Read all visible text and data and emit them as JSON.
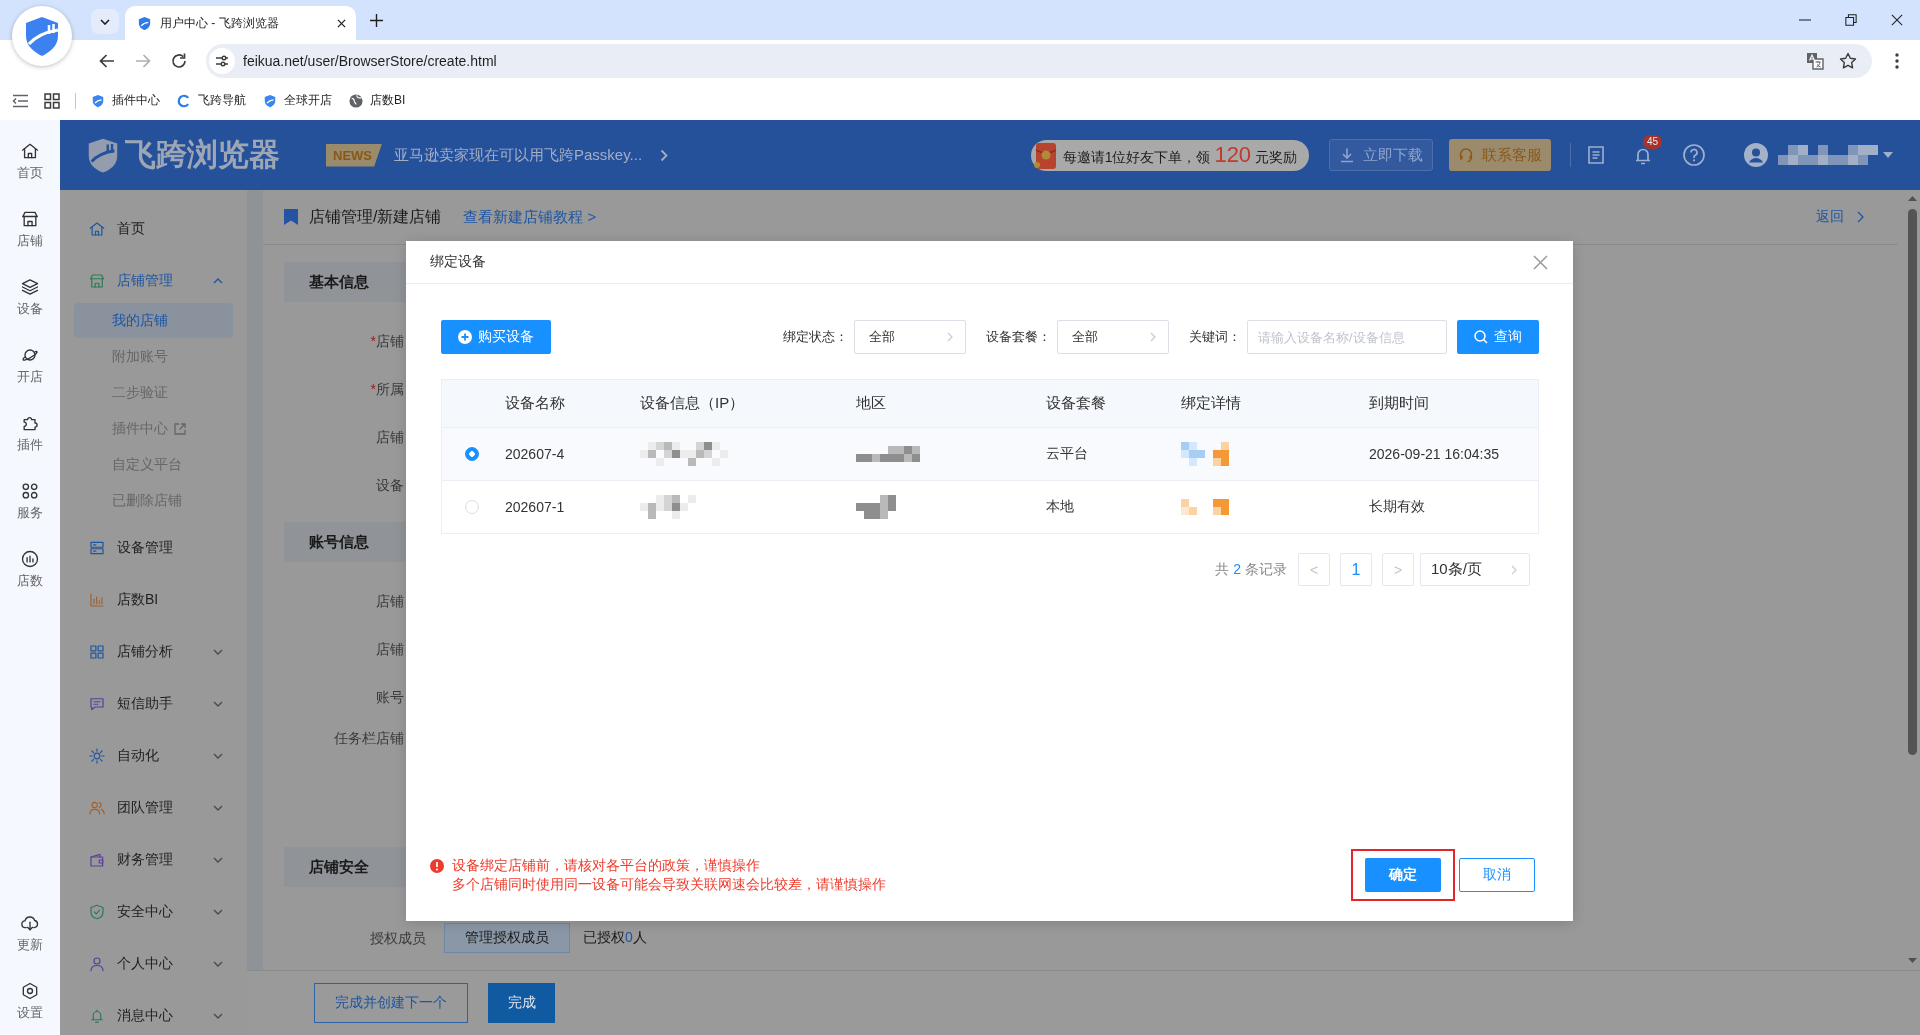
{
  "browser": {
    "tabs": [
      {
        "title": "用户中心 - 飞跨浏览器",
        "selected": true
      }
    ],
    "url": "feikua.net/user/BrowserStore/create.html",
    "bookmarks": [
      {
        "label": "插件中心"
      },
      {
        "label": "飞跨导航"
      },
      {
        "label": "全球开店"
      },
      {
        "label": "店数BI"
      }
    ]
  },
  "rail": {
    "items": [
      {
        "label": "首页",
        "selected": false
      },
      {
        "label": "店铺",
        "selected": false
      },
      {
        "label": "设备",
        "selected": false
      },
      {
        "label": "开店",
        "selected": false
      },
      {
        "label": "插件",
        "selected": false
      },
      {
        "label": "服务",
        "selected": false
      },
      {
        "label": "店数",
        "selected": false
      }
    ],
    "bottom_items": [
      {
        "label": "更新"
      },
      {
        "label": "设置"
      }
    ]
  },
  "header": {
    "brand": "飞跨浏览器",
    "news_tag": "NEWS",
    "news": "亚马逊卖家现在可以用飞跨Passkey...",
    "invite": {
      "before": "每邀请1位好友下单，领",
      "amount": "120",
      "after": "元奖励"
    },
    "download_button": "立即下载",
    "service_button": "联系客服",
    "notification_count": "45"
  },
  "sidebar": {
    "items": [
      {
        "label": "首页",
        "kind": "link",
        "selected": false
      },
      {
        "label": "店铺管理",
        "kind": "group",
        "selected": true,
        "expanded": true,
        "children": [
          {
            "label": "我的店铺",
            "selected": true,
            "external": false
          },
          {
            "label": "附加账号",
            "selected": false,
            "external": false
          },
          {
            "label": "二步验证",
            "selected": false,
            "external": false
          },
          {
            "label": "插件中心",
            "selected": false,
            "external": true
          },
          {
            "label": "自定义平台",
            "selected": false,
            "external": false
          },
          {
            "label": "已删除店铺",
            "selected": false,
            "external": false
          }
        ]
      },
      {
        "label": "设备管理",
        "kind": "link",
        "selected": false
      },
      {
        "label": "店数BI",
        "kind": "link",
        "selected": false
      },
      {
        "label": "店铺分析",
        "kind": "group",
        "selected": false,
        "expanded": false
      },
      {
        "label": "短信助手",
        "kind": "group",
        "selected": false,
        "expanded": false
      },
      {
        "label": "自动化",
        "kind": "group",
        "selected": false,
        "expanded": false
      },
      {
        "label": "团队管理",
        "kind": "group",
        "selected": false,
        "expanded": false
      },
      {
        "label": "财务管理",
        "kind": "group",
        "selected": false,
        "expanded": false
      },
      {
        "label": "安全中心",
        "kind": "group",
        "selected": false,
        "expanded": false
      },
      {
        "label": "个人中心",
        "kind": "group",
        "selected": false,
        "expanded": false
      },
      {
        "label": "消息中心",
        "kind": "group",
        "selected": false,
        "expanded": false
      }
    ]
  },
  "page": {
    "breadcrumb": "店铺管理/新建店铺",
    "tutorial_link": "查看新建店铺教程 >",
    "back_link": "返回",
    "sections": [
      {
        "title": "基本信息",
        "fields": [
          {
            "required_mark": "*",
            "label": "店铺"
          },
          {
            "required_mark": "*",
            "label": "所属"
          },
          {
            "label": "店铺"
          },
          {
            "label": "设备"
          }
        ]
      },
      {
        "title": "账号信息",
        "fields": [
          {
            "label": "店铺"
          },
          {
            "label": "店铺"
          },
          {
            "label": "账号"
          },
          {
            "label": "任务栏店铺"
          }
        ]
      },
      {
        "title": "店铺安全",
        "members": {
          "label": "授权成员",
          "button": "管理授权成员",
          "count_before": "已授权",
          "count": "0",
          "count_after": "人"
        }
      }
    ],
    "actions": {
      "next_button": "完成并创建下一个",
      "done_button": "完成"
    }
  },
  "dialog": {
    "title": "绑定设备",
    "buy_button": "购买设备",
    "filters": [
      {
        "label": "绑定状态：",
        "value": "全部"
      },
      {
        "label": "设备套餐：",
        "value": "全部"
      }
    ],
    "keyword": {
      "label": "关键词：",
      "placeholder": "请输入设备名称/设备信息"
    },
    "query_button": "查询",
    "table": {
      "columns": [
        "设备名称",
        "设备信息（IP）",
        "地区",
        "设备套餐",
        "绑定详情",
        "到期时间"
      ],
      "rows": [
        {
          "selected": true,
          "name": "202607-4",
          "plan": "云平台",
          "expiry": "2026-09-21 16:04:35"
        },
        {
          "selected": false,
          "name": "202607-1",
          "plan": "本地",
          "expiry": "长期有效"
        }
      ]
    },
    "pagination": {
      "total_before": "共",
      "total": "2",
      "total_after": "条记录",
      "prev": {
        "label": "<",
        "disabled": true
      },
      "pages": [
        {
          "label": "1",
          "selected": true
        }
      ],
      "next": {
        "label": ">",
        "disabled": true
      },
      "page_size": "10条/页"
    },
    "warnings": [
      "设备绑定店铺前，请核对各平台的政策，谨慎操作",
      "多个店铺同时使用同一设备可能会导致关联网速会比较差，请谨慎操作"
    ],
    "confirm_button": "确定",
    "cancel_button": "取消"
  }
}
